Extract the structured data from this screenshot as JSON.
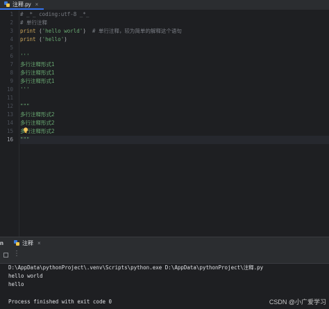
{
  "editor_tab": {
    "filename": "注释.py",
    "close": "×"
  },
  "line_numbers": [
    "1",
    "2",
    "3",
    "4",
    "5",
    "6",
    "7",
    "8",
    "9",
    "10",
    "11",
    "12",
    "13",
    "14",
    "15",
    "16"
  ],
  "code": {
    "l1": "# _*_ coding:utf-8 _*_",
    "l2": "# 单行注释",
    "l3_fn": "print",
    "l3_open": " (",
    "l3_str": "'hello world'",
    "l3_close": ")",
    "l3_comment": "  # 单行注释，较为简单的解释这个语句",
    "l4_fn": "print",
    "l4_open": " (",
    "l4_str": "'hello'",
    "l4_close": ")",
    "l6": "'''",
    "l7": "多行注释形式1",
    "l8": "多行注释形式1",
    "l9": "多行注释形式1",
    "l10": "'''",
    "l12": "\"\"\"",
    "l13": "多行注释形式2",
    "l14": "多行注释形式2",
    "l15": "多行注释形式2",
    "l16": "\"\"\""
  },
  "run_panel": {
    "tool_label": "n",
    "tab_label": "注释",
    "tab_close": "×",
    "more": "⋮"
  },
  "console": {
    "command": "D:\\AppData\\pythonProject\\.venv\\Scripts\\python.exe D:\\AppData\\pythonProject\\注释.py",
    "out1": "hello world",
    "out2": "hello",
    "exit": "Process finished with exit code 0"
  },
  "watermark": "CSDN @小广爱学习"
}
